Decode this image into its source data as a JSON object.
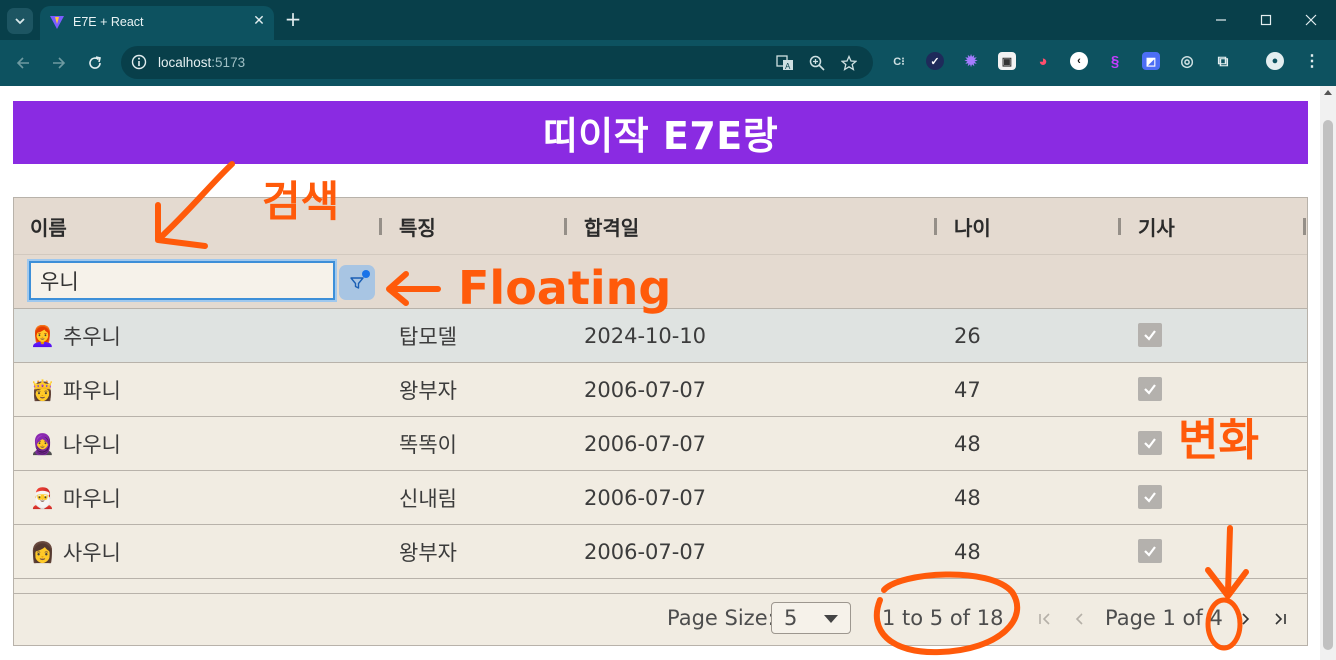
{
  "browser": {
    "tab_title": "E7E + React",
    "url_host": "localhost",
    "url_port": ":5173"
  },
  "page": {
    "title": "띠이작 E7E랑"
  },
  "grid": {
    "columns": [
      "이름",
      "특징",
      "합격일",
      "나이",
      "기사"
    ],
    "filter_value": "우니",
    "rows": [
      {
        "avatar": "👩‍🦰",
        "name": "추우니",
        "trait": "탑모델",
        "date": "2024-10-10",
        "age": "26",
        "checked": true,
        "selected": true
      },
      {
        "avatar": "👸",
        "name": "파우니",
        "trait": "왕부자",
        "date": "2006-07-07",
        "age": "47",
        "checked": true,
        "selected": false
      },
      {
        "avatar": "🧕",
        "name": "나우니",
        "trait": "똑똑이",
        "date": "2006-07-07",
        "age": "48",
        "checked": true,
        "selected": false
      },
      {
        "avatar": "🎅",
        "name": "마우니",
        "trait": "신내림",
        "date": "2006-07-07",
        "age": "48",
        "checked": true,
        "selected": false
      },
      {
        "avatar": "👩",
        "name": "사우니",
        "trait": "왕부자",
        "date": "2006-07-07",
        "age": "48",
        "checked": true,
        "selected": false
      }
    ],
    "pagination": {
      "page_size_label": "Page Size:",
      "page_size": "5",
      "summary": "1 to 5 of 18",
      "page_desc": "Page 1 of 4"
    }
  },
  "annotations": {
    "search": "검색",
    "floating": "Floating",
    "change": "변화"
  },
  "colors": {
    "header_purple": "#8a2be2",
    "annotation_orange": "#ff5a0a",
    "chrome_teal": "#0d5260"
  }
}
